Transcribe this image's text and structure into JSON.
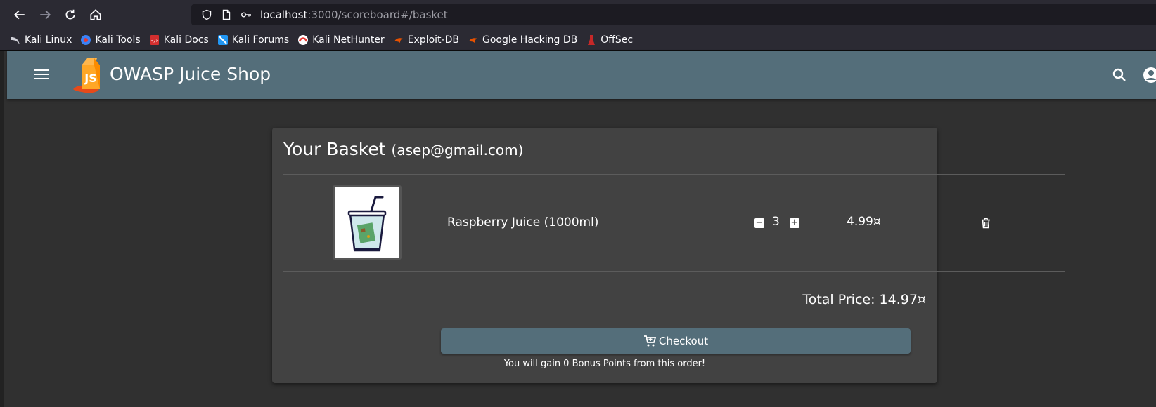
{
  "browser": {
    "url_host": "localhost",
    "url_rest": ":3000/scoreboard#/basket",
    "bookmarks": [
      {
        "label": "Kali Linux",
        "color": "#4a8cff"
      },
      {
        "label": "Kali Tools",
        "color": "#3b82f6"
      },
      {
        "label": "Kali Docs",
        "color": "#d32f2f"
      },
      {
        "label": "Kali Forums",
        "color": "#2196f3"
      },
      {
        "label": "Kali NetHunter",
        "color": "#e53935"
      },
      {
        "label": "Exploit-DB",
        "color": "#e65100"
      },
      {
        "label": "Google Hacking DB",
        "color": "#e65100"
      },
      {
        "label": "OffSec",
        "color": "#c62828"
      }
    ]
  },
  "app": {
    "title": "OWASP Juice Shop",
    "accent": "#546e7a"
  },
  "basket": {
    "heading": "Your Basket",
    "email": "(asep@gmail.com)",
    "items": [
      {
        "name": "Raspberry Juice (1000ml)",
        "quantity": "3",
        "price": "4.99¤"
      }
    ],
    "total": "Total Price: 14.97¤",
    "checkout_label": "Checkout",
    "bonus_text": "You will gain 0 Bonus Points from this order!"
  }
}
